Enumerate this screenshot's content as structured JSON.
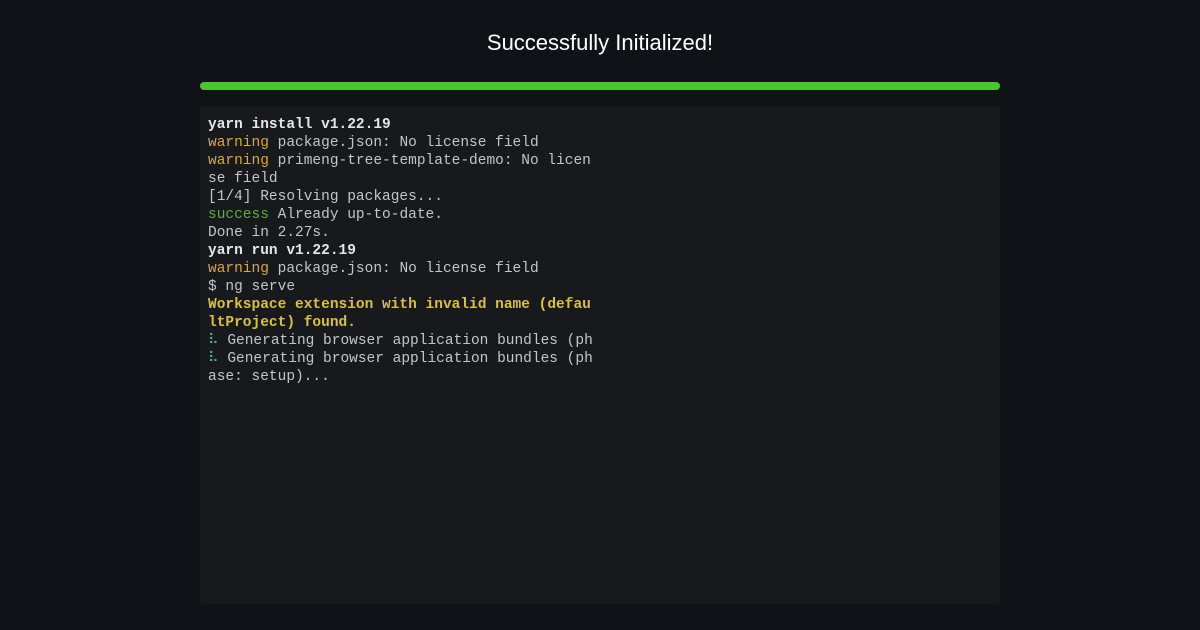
{
  "header": {
    "title": "Successfully Initialized!"
  },
  "colors": {
    "background": "#0f1216",
    "terminal_bg": "#17191c",
    "progress": "#4ac72b",
    "text": "#c2c6cc",
    "bold_white": "#e6e6e6",
    "warning": "#d9a93a",
    "success": "#5fae3e",
    "yellow_bold": "#d9c23a",
    "spinner": "#4fb0a0"
  },
  "terminal": {
    "line1_bold": "yarn install v1.22.19",
    "line2_warning": "warning",
    "line2_rest": " package.json: No license field",
    "line3_warning": "warning",
    "line3_rest": " primeng-tree-template-demo: No licen",
    "line4": "se field",
    "line5": "[1/4] Resolving packages...",
    "line6_success": "success",
    "line6_rest": " Already up-to-date.",
    "line7": "Done in 2.27s.",
    "line8_bold": "yarn run v1.22.19",
    "line9_warning": "warning",
    "line9_rest": " package.json: No license field",
    "line10": "$ ng serve",
    "line11_yellow": "Workspace extension with invalid name (defau",
    "line12_yellow": "ltProject) found.",
    "line13_spinner": "⠧",
    "line13_rest": " Generating browser application bundles (ph",
    "line14_spinner": "⠧",
    "line14_rest": " Generating browser application bundles (ph",
    "line15": "ase: setup)..."
  }
}
